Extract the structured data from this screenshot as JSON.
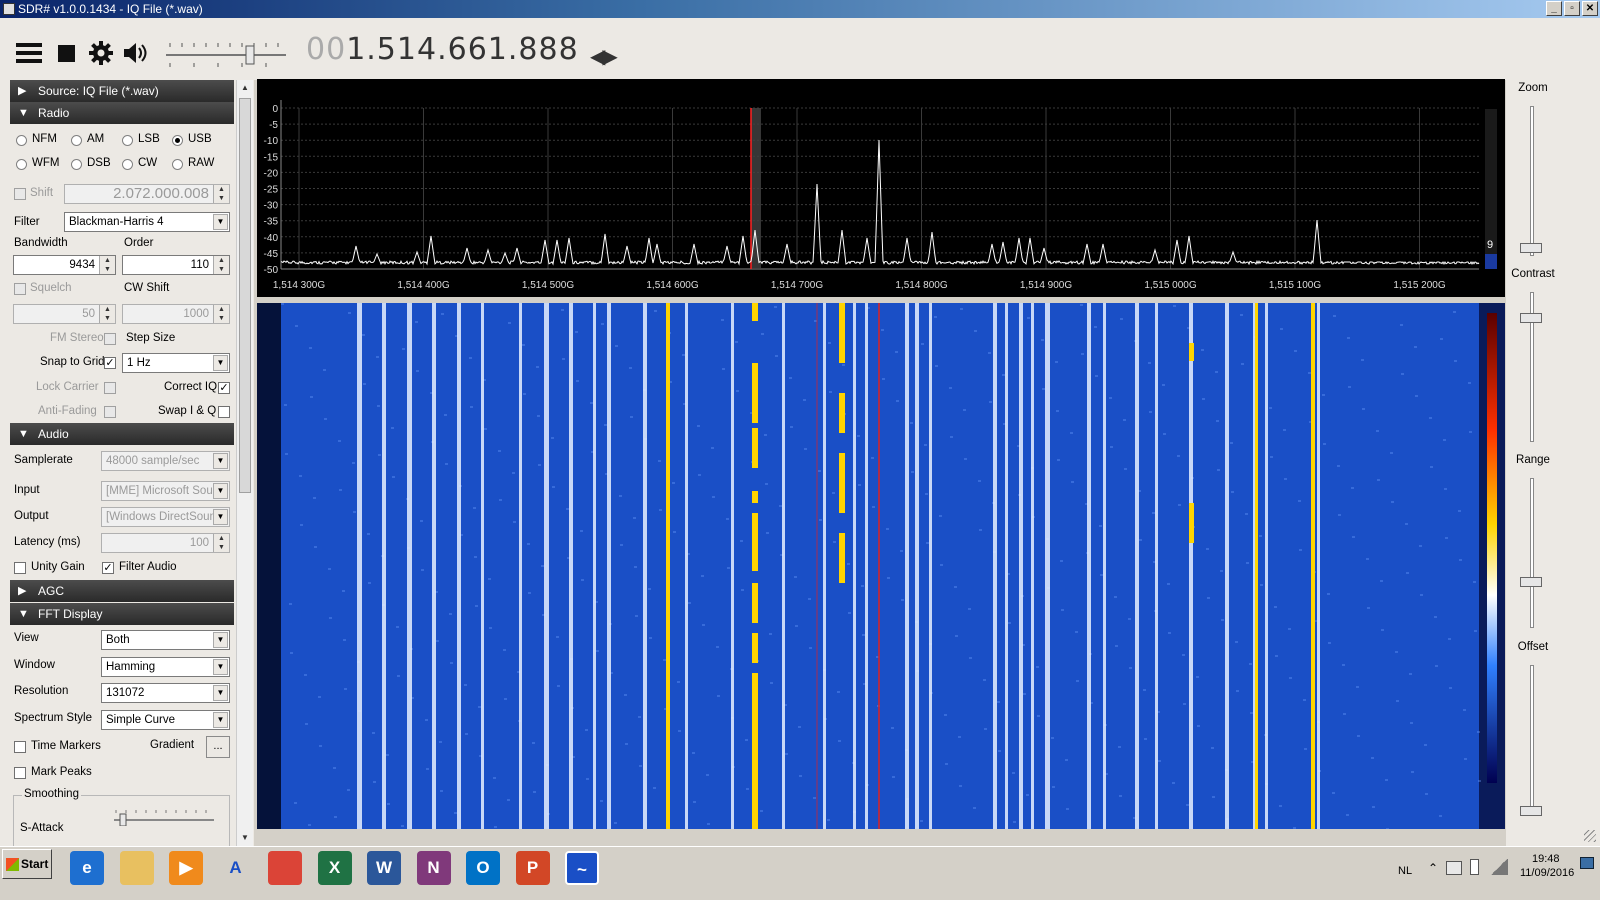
{
  "window": {
    "title": "SDR# v1.0.0.1434 - IQ File (*.wav)",
    "buttons": [
      "_",
      "▫",
      "✕"
    ]
  },
  "toolbar": {
    "icons": [
      "menu-icon",
      "stop-icon",
      "gear-icon",
      "speaker-icon",
      "volume-slider",
      "tuning-arrows-icon"
    ],
    "frequency_dim": "00",
    "frequency": "1.514.661.888"
  },
  "sidebar": {
    "source_header": "Source: IQ File (*.wav)",
    "radio_header": "Radio",
    "modes": [
      {
        "label": "NFM",
        "selected": false
      },
      {
        "label": "AM",
        "selected": false
      },
      {
        "label": "LSB",
        "selected": false
      },
      {
        "label": "USB",
        "selected": true
      },
      {
        "label": "WFM",
        "selected": false
      },
      {
        "label": "DSB",
        "selected": false
      },
      {
        "label": "CW",
        "selected": false
      },
      {
        "label": "RAW",
        "selected": false
      }
    ],
    "shift_label": "Shift",
    "shift_value": "2.072.000.008",
    "filter_label": "Filter",
    "filter_value": "Blackman-Harris 4",
    "bandwidth_label": "Bandwidth",
    "bandwidth_value": "9434",
    "order_label": "Order",
    "order_value": "110",
    "squelch_label": "Squelch",
    "squelch_value": "50",
    "cwshift_label": "CW Shift",
    "cwshift_value": "1000",
    "fmstereo_label": "FM Stereo",
    "stepsize_label": "Step Size",
    "snap_label": "Snap to Grid",
    "snap_value": "1 Hz",
    "lockcarrier_label": "Lock Carrier",
    "correctiq_label": "Correct IQ",
    "antifading_label": "Anti-Fading",
    "swapiq_label": "Swap I & Q",
    "audio_header": "Audio",
    "samplerate_label": "Samplerate",
    "samplerate_value": "48000 sample/sec",
    "input_label": "Input",
    "input_value": "[MME] Microsoft Soun",
    "output_label": "Output",
    "output_value": "[Windows DirectSound",
    "latency_label": "Latency (ms)",
    "latency_value": "100",
    "unitygain_label": "Unity Gain",
    "filteraudio_label": "Filter Audio",
    "agc_header": "AGC",
    "fft_header": "FFT Display",
    "view_label": "View",
    "view_value": "Both",
    "window_label": "Window",
    "window_value": "Hamming",
    "resolution_label": "Resolution",
    "resolution_value": "131072",
    "spectrumstyle_label": "Spectrum Style",
    "spectrumstyle_value": "Simple Curve",
    "timemarkers_label": "Time Markers",
    "gradient_label": "Gradient",
    "gradient_button": "...",
    "markpeaks_label": "Mark Peaks",
    "smoothing_label": "Smoothing",
    "sattack_label": "S-Attack"
  },
  "spectrum": {
    "y_ticks": [
      "0",
      "-5",
      "-10",
      "-15",
      "-20",
      "-25",
      "-30",
      "-35",
      "-40",
      "-45",
      "-50"
    ],
    "x_ticks": [
      "1,514 300G",
      "1,514 400G",
      "1,514 500G",
      "1,514 600G",
      "1,514 700G",
      "1,514 800G",
      "1,514 900G",
      "1,515 000G",
      "1,515 100G",
      "1,515 200G"
    ],
    "level_value": "9",
    "colors": {
      "background": "#000000",
      "trace": "#ffffff",
      "grid": "#3a3a3a",
      "cursor": "#ff2020"
    }
  },
  "waterfall": {
    "colors": {
      "background": "#1a4fc6",
      "bright": "#e8f0ff",
      "hot": "#ffd400",
      "cursor": "#e02020"
    }
  },
  "right_panel": {
    "zoom_label": "Zoom",
    "contrast_label": "Contrast",
    "range_label": "Range",
    "offset_label": "Offset"
  },
  "taskbar": {
    "start_label": "Start",
    "apps": [
      {
        "name": "internet-explorer-icon",
        "glyph": "e",
        "color": "#1e6fd0"
      },
      {
        "name": "file-explorer-icon",
        "glyph": "",
        "color": "#e8c060"
      },
      {
        "name": "media-player-icon",
        "glyph": "▶",
        "color": "#f08a1c"
      },
      {
        "name": "a-app-icon",
        "glyph": "A",
        "color": "#ffffff"
      },
      {
        "name": "chrome-icon",
        "glyph": "",
        "color": "#db4437"
      },
      {
        "name": "excel-icon",
        "glyph": "X",
        "color": "#1f7244"
      },
      {
        "name": "word-icon",
        "glyph": "W",
        "color": "#2b579a"
      },
      {
        "name": "onenote-icon",
        "glyph": "N",
        "color": "#80397b"
      },
      {
        "name": "outlook-icon",
        "glyph": "O",
        "color": "#0072c6"
      },
      {
        "name": "powerpoint-icon",
        "glyph": "P",
        "color": "#d24726"
      },
      {
        "name": "sdrsharp-icon",
        "glyph": "~",
        "color": "#1a4fc6"
      }
    ],
    "language": "NL",
    "time": "19:48",
    "date": "11/09/2016"
  }
}
